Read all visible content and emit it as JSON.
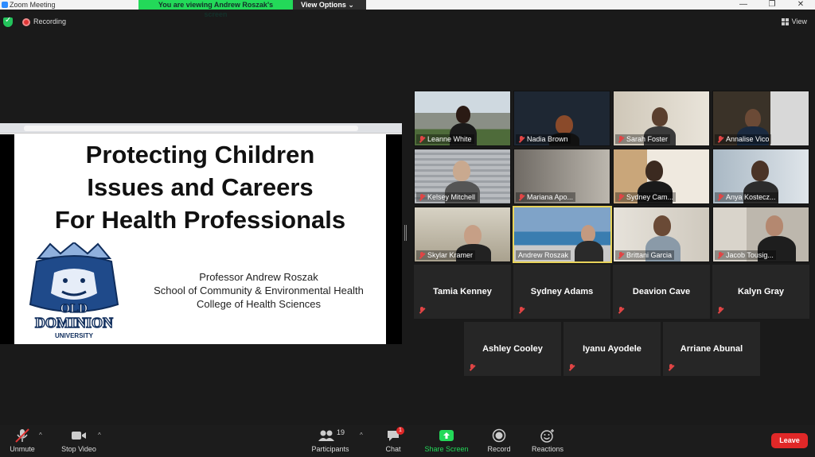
{
  "window": {
    "title": "Zoom Meeting",
    "controls": [
      "—",
      "❐",
      "✕"
    ]
  },
  "banner": {
    "viewing": "You are viewing Andrew Roszak's screen",
    "view_options": "View Options ⌄"
  },
  "status": {
    "recording": "Recording",
    "view": "View"
  },
  "slide": {
    "title_lines": [
      "Protecting Children",
      "Issues and Careers",
      "For Health Professionals"
    ],
    "presenter_lines": [
      "Professor Andrew Roszak",
      "School of Community & Environmental Health",
      "College of Health Sciences"
    ],
    "logo_text": [
      "OLD",
      "DOMINION",
      "UNIVERSITY"
    ]
  },
  "participants": {
    "video": [
      {
        "name": "Leanne White"
      },
      {
        "name": "Nadia Brown"
      },
      {
        "name": "Sarah Foster"
      },
      {
        "name": "Annalise Vico"
      },
      {
        "name": "Kelsey Mitchell"
      },
      {
        "name": "Mariana Apo..."
      },
      {
        "name": "Sydney Cam..."
      },
      {
        "name": "Anya Kostecz..."
      },
      {
        "name": "Skylar Kramer"
      },
      {
        "name": "Andrew Roszak"
      },
      {
        "name": "Brittani Garcia"
      },
      {
        "name": "Jacob Tousig..."
      }
    ],
    "name_only": [
      {
        "name": "Tamia Kenney"
      },
      {
        "name": "Sydney Adams"
      },
      {
        "name": "Deavion Cave"
      },
      {
        "name": "Kalyn Gray"
      },
      {
        "name": "Ashley Cooley"
      },
      {
        "name": "Iyanu Ayodele"
      },
      {
        "name": "Arriane Abunal"
      }
    ]
  },
  "toolbar": {
    "unmute": "Unmute",
    "stop_video": "Stop Video",
    "participants": "Participants",
    "participants_count": "19",
    "chat": "Chat",
    "chat_badge": "1",
    "share_screen": "Share Screen",
    "record": "Record",
    "reactions": "Reactions",
    "leave": "Leave"
  },
  "colors": {
    "accent_green": "#23d959",
    "leave_red": "#e02828",
    "active_speaker": "#e8d35a"
  }
}
